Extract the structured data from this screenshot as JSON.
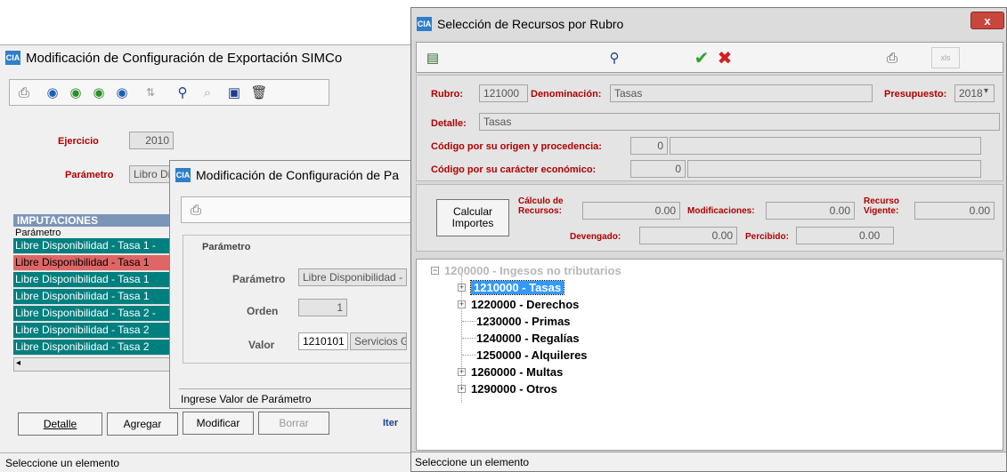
{
  "left_window": {
    "title": "Modificación de Configuración de Exportación SIMCo",
    "ejercicio_label": "Ejercicio",
    "ejercicio_value": "2010",
    "parametro_label": "Parámetro",
    "parametro_value": "Libro Di",
    "imputaciones_header": "IMPUTACIONES",
    "col_header": "Parámetro",
    "rows": [
      "Libre Disponibilidad - Tasa 1 -",
      "Libre Disponibilidad - Tasa 1",
      "Libre Disponibilidad - Tasa 1",
      "Libre Disponibilidad - Tasa 1",
      "Libre Disponibilidad - Tasa 2 -",
      "Libre Disponibilidad - Tasa 2",
      "Libre Disponibilidad - Tasa 2"
    ],
    "btn_detalle": "Detalle",
    "btn_agregar": "Agregar",
    "status": "Seleccione un elemento"
  },
  "middle_window": {
    "title": "Modificación de Configuración de Pa",
    "group_label": "Parámetro",
    "parametro_label": "Parámetro",
    "parametro_value": "Libre Disponibilidad -",
    "orden_label": "Orden",
    "orden_value": "1",
    "valor_label": "Valor",
    "valor_value": "1210101",
    "valor_desc": "Servicios G",
    "status": "Ingrese Valor de Parámetro",
    "btn_modificar": "Modificar",
    "btn_borrar": "Borrar",
    "iter_text": "Iter"
  },
  "right_window": {
    "title": "Selección de Recursos por Rubro",
    "close_glyph": "x",
    "rubro_label": "Rubro:",
    "rubro_value": "121000",
    "denominacion_label": "Denominación:",
    "denominacion_value": "Tasas",
    "presupuesto_label": "Presupuesto:",
    "presupuesto_value": "2018",
    "detalle_label": "Detalle:",
    "detalle_value": "Tasas",
    "origen_label": "Código por su origen y procedencia:",
    "origen_value": "0",
    "caracter_label": "Código por su carácter económico:",
    "caracter_value": "0",
    "calcular_label": "Calcular Importes",
    "calculo_label": "Cálculo de Recursos:",
    "calculo_value": "0.00",
    "modificaciones_label": "Modificaciones:",
    "modificaciones_value": "0.00",
    "recurso_label": "Recurso Vigente:",
    "recurso_value": "0.00",
    "devengado_label": "Devengado:",
    "devengado_value": "0.00",
    "percibido_label": "Percibido:",
    "percibido_value": "0.00",
    "tree_root": "1200000 - Ingesos no tributarios",
    "tree_items": [
      "1210000 - Tasas",
      "1220000 - Derechos",
      "1230000 - Primas",
      "1240000 - Regalías",
      "1250000 - Alquileres",
      "1260000 - Multas",
      "1290000 - Otros"
    ],
    "status": "Seleccione un elemento"
  }
}
